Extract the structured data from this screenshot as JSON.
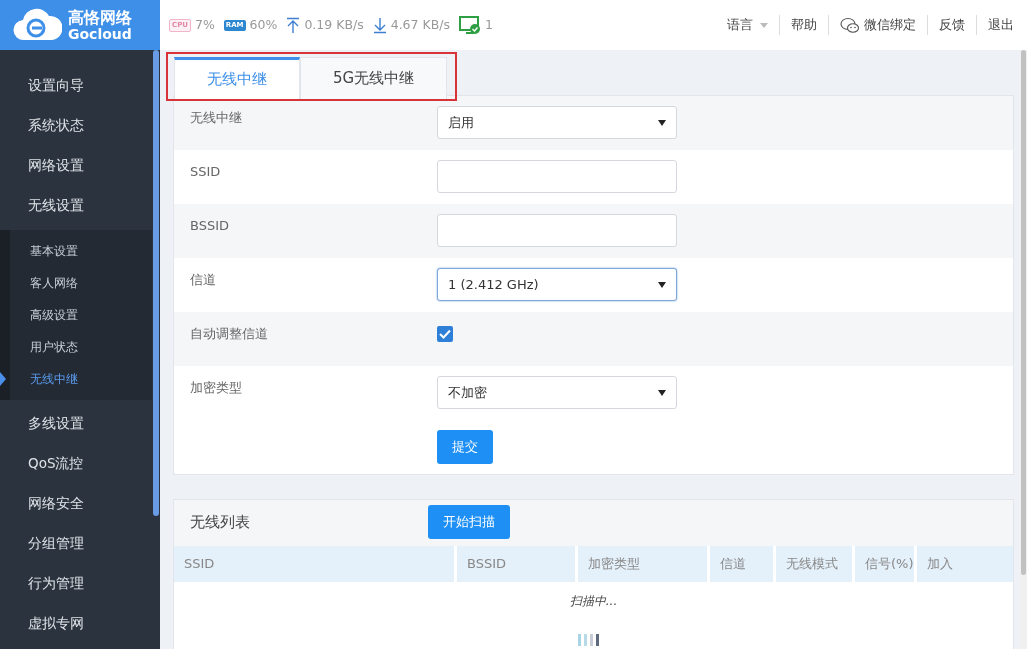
{
  "brand": {
    "name": "高恪网络",
    "sub": "Gocloud"
  },
  "stats": [
    {
      "kind": "cpu",
      "label": "CPU",
      "value": "7%"
    },
    {
      "kind": "ram",
      "label": "RAM",
      "value": "60%"
    },
    {
      "kind": "up",
      "value": "0.19 KB/s"
    },
    {
      "kind": "down",
      "value": "4.67 KB/s"
    },
    {
      "kind": "clients",
      "value": "1"
    }
  ],
  "top_links": [
    {
      "label": "语言",
      "dropdown": true
    },
    {
      "label": "帮助"
    },
    {
      "label": "微信绑定",
      "kind": "wechat"
    },
    {
      "label": "反馈"
    },
    {
      "label": "退出"
    }
  ],
  "sidebar": {
    "items": [
      {
        "label": "设置向导"
      },
      {
        "label": "系统状态"
      },
      {
        "label": "网络设置"
      },
      {
        "label": "无线设置",
        "children": [
          {
            "label": "基本设置",
            "selected": false
          },
          {
            "label": "客人网络",
            "selected": false
          },
          {
            "label": "高级设置",
            "selected": false
          },
          {
            "label": "用户状态",
            "selected": false
          },
          {
            "label": "无线中继",
            "selected": true
          }
        ]
      },
      {
        "label": "多线设置"
      },
      {
        "label": "QoS流控"
      },
      {
        "label": "网络安全"
      },
      {
        "label": "分组管理"
      },
      {
        "label": "行为管理"
      },
      {
        "label": "虚拟专网"
      }
    ]
  },
  "tabs": {
    "highlighted": true,
    "items": [
      {
        "label": "无线中继",
        "selected": true
      },
      {
        "label": "5G无线中继",
        "selected": false
      }
    ]
  },
  "form": {
    "fields": [
      {
        "kind": "select",
        "label": "无线中继",
        "value": "启用",
        "focused": false
      },
      {
        "kind": "text",
        "label": "SSID",
        "focused": false
      },
      {
        "kind": "text",
        "label": "BSSID",
        "focused": false
      },
      {
        "kind": "select",
        "label": "信道",
        "value": "1 (2.412 GHz)",
        "focused": true
      },
      {
        "kind": "checkbox",
        "label": "自动调整信道",
        "checked": true
      },
      {
        "kind": "select",
        "label": "加密类型",
        "value": "不加密",
        "focused": false
      }
    ],
    "submit": "提交"
  },
  "wireless_list": {
    "title": "无线列表",
    "scan_button": "开始扫描",
    "columns": [
      "SSID",
      "BSSID",
      "加密类型",
      "信道",
      "无线模式",
      "信号(%)",
      "加入"
    ],
    "status": "扫描中..."
  }
}
